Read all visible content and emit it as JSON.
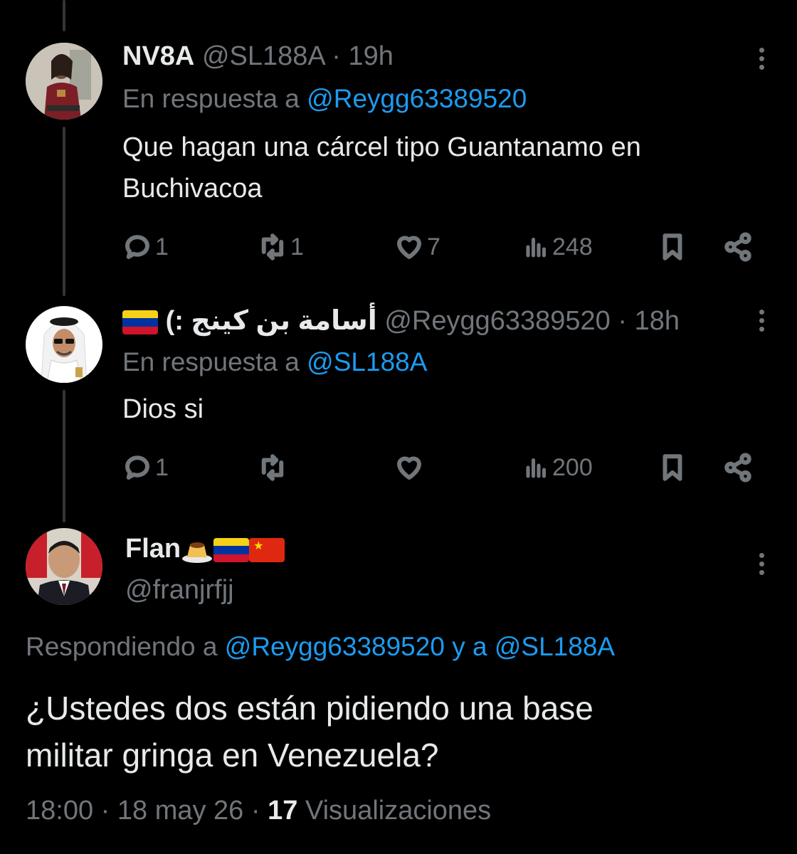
{
  "tweets": [
    {
      "name": "NV8A",
      "handle": "@SL188A",
      "sep": "·",
      "time": "19h",
      "reply_prefix": "En respuesta a",
      "reply_to": "@Reygg63389520",
      "text_line1": "Que hagan una cárcel tipo Guantanamo en",
      "text_line2": "Buchivacoa",
      "replies": "1",
      "retweets": "1",
      "likes": "7",
      "views": "248"
    },
    {
      "name": "أسامة بن كينج :)",
      "handle": "@Reygg63389520",
      "sep": "·",
      "time": "18h",
      "reply_prefix": "En respuesta a",
      "reply_to": "@SL188A",
      "text_line1": "Dios si",
      "replies": "1",
      "retweets": "",
      "likes": "",
      "views": "200"
    }
  ],
  "main": {
    "name": "Flan",
    "handle": "@franjrfjj",
    "reply_prefix": "Respondiendo a",
    "reply_to_1": "@Reygg63389520",
    "reply_join": "y a",
    "reply_to_2": "@SL188A",
    "text_line1": "¿Ustedes dos están pidiendo una base",
    "text_line2": "militar gringa en Venezuela?",
    "time": "18:00",
    "sep": "·",
    "date": "18 may 26",
    "views_count": "17",
    "views_label": "Visualizaciones"
  },
  "colors": {
    "background": "#000000",
    "text": "#e7e9ea",
    "muted": "#71767b",
    "link": "#1d9bf0"
  },
  "icons": [
    "reply-icon",
    "retweet-icon",
    "like-icon",
    "views-icon",
    "bookmark-icon",
    "share-icon",
    "more-icon"
  ]
}
